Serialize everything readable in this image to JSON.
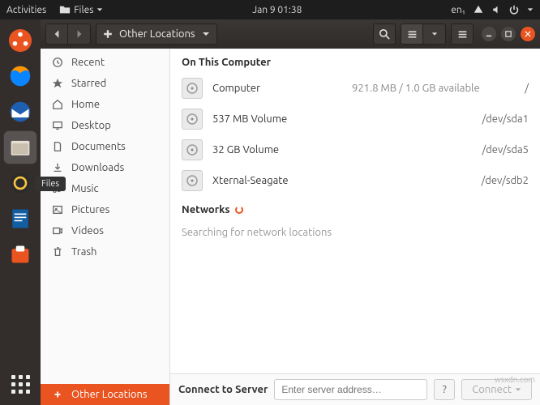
{
  "panel": {
    "activities": "Activities",
    "app_menu_label": "Files",
    "clock": "Jan 9  01:38",
    "input_source": "en₁"
  },
  "dock": {
    "tooltip": "Files"
  },
  "headerbar": {
    "location": "Other Locations"
  },
  "sidebar": {
    "items": [
      {
        "label": "Recent"
      },
      {
        "label": "Starred"
      },
      {
        "label": "Home"
      },
      {
        "label": "Desktop"
      },
      {
        "label": "Documents"
      },
      {
        "label": "Downloads"
      },
      {
        "label": "Music"
      },
      {
        "label": "Pictures"
      },
      {
        "label": "Videos"
      },
      {
        "label": "Trash"
      }
    ],
    "other_locations": "Other Locations"
  },
  "content": {
    "on_this_computer": "On This Computer",
    "drives": [
      {
        "name": "Computer",
        "size": "921.8 MB / 1.0 GB available",
        "mount": "/"
      },
      {
        "name": "537 MB Volume",
        "size": "",
        "mount": "/dev/sda1"
      },
      {
        "name": "32 GB Volume",
        "size": "",
        "mount": "/dev/sda5"
      },
      {
        "name": "Xternal-Seagate",
        "size": "",
        "mount": "/dev/sdb2"
      }
    ],
    "networks": "Networks",
    "network_status": "Searching for network locations"
  },
  "footer": {
    "label": "Connect to Server",
    "placeholder": "Enter server address…",
    "connect": "Connect"
  },
  "watermark": "wsxdn.com"
}
